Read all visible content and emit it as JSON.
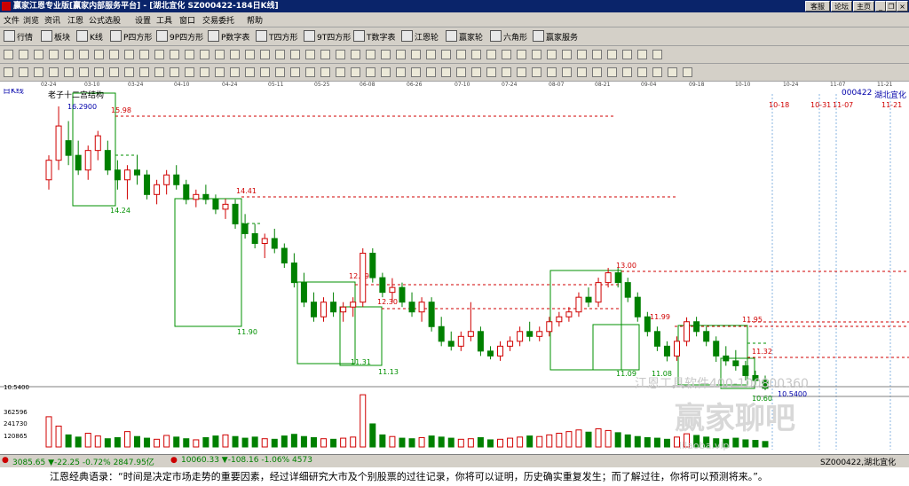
{
  "window": {
    "title": "赢家江恩专业版[赢家内部服务平台] - [湖北宜化  SZ000422-184日K线]",
    "buttons": [
      "客服",
      "论坛",
      "主页"
    ]
  },
  "menu": [
    "文件",
    "浏览",
    "资讯",
    "江恩",
    "公式选股",
    "设置",
    "工具",
    "窗口",
    "交易委托",
    "帮助"
  ],
  "toolbar1": [
    "行情",
    "板块",
    "K线",
    "P四方形",
    "9P四方形",
    "P数字表",
    "T四方形",
    "9T四方形",
    "T数字表",
    "江恩轮",
    "赢家轮",
    "六角形",
    "赢家服务"
  ],
  "chart": {
    "period_label": "日K线",
    "study_label": "老子十二宫结构",
    "stock_code": "000422",
    "stock_name": "湖北宜化",
    "top_dates": [
      "02-24",
      "03-10",
      "03-24",
      "04-10",
      "04-24",
      "05-11",
      "05-25",
      "06-08",
      "06-26",
      "07-10",
      "07-24",
      "08-07",
      "08-21",
      "09-04",
      "09-18",
      "10-10",
      "10-24",
      "11-07",
      "11-21"
    ],
    "future_dates": [
      "10-18",
      "10-31",
      "11-07",
      "11-21"
    ],
    "price_labels": [
      "16.2900",
      "15.98",
      "14.41",
      "14.24",
      "11.90",
      "12.79",
      "12.30",
      "11.31",
      "11.13",
      "13.00",
      "11.99",
      "11.95",
      "11.09",
      "11.08",
      "11.32",
      "10.60",
      "10.5400"
    ],
    "watermark": "江恩工具软件400-100800360",
    "volume_axis": [
      "10.5400",
      "362596",
      "241730",
      "120865"
    ],
    "volume_watermark_brand": "赢家聊吧",
    "volume_watermark_url": "lilaoba.vip"
  },
  "candles": [
    [
      14.8,
      15.3,
      14.6,
      15.2
    ],
    [
      15.2,
      16.3,
      15.0,
      15.9
    ],
    [
      15.6,
      16.0,
      15.1,
      15.3
    ],
    [
      15.3,
      15.6,
      14.9,
      15.0
    ],
    [
      15.0,
      15.5,
      14.8,
      15.4
    ],
    [
      15.4,
      15.8,
      15.2,
      15.7
    ],
    [
      15.4,
      15.6,
      14.9,
      15.0
    ],
    [
      15.0,
      15.2,
      14.6,
      14.8
    ],
    [
      14.8,
      15.1,
      14.4,
      15.0
    ],
    [
      15.0,
      15.3,
      14.7,
      14.9
    ],
    [
      14.9,
      15.0,
      14.4,
      14.5
    ],
    [
      14.5,
      14.8,
      14.3,
      14.7
    ],
    [
      14.7,
      15.0,
      14.5,
      14.9
    ],
    [
      14.9,
      15.1,
      14.6,
      14.7
    ],
    [
      14.7,
      14.8,
      14.3,
      14.4
    ],
    [
      14.4,
      14.6,
      14.24,
      14.5
    ],
    [
      14.5,
      14.7,
      14.3,
      14.4
    ],
    [
      14.4,
      14.5,
      14.1,
      14.2
    ],
    [
      14.2,
      14.41,
      14.0,
      14.3
    ],
    [
      14.3,
      14.4,
      13.8,
      13.9
    ],
    [
      13.9,
      14.1,
      13.6,
      13.7
    ],
    [
      13.7,
      13.9,
      13.4,
      13.5
    ],
    [
      13.5,
      13.7,
      13.2,
      13.6
    ],
    [
      13.6,
      13.8,
      13.3,
      13.4
    ],
    [
      13.4,
      13.5,
      13.0,
      13.1
    ],
    [
      13.1,
      13.3,
      12.6,
      12.7
    ],
    [
      12.7,
      12.9,
      12.2,
      12.3
    ],
    [
      12.3,
      12.5,
      11.9,
      12.0
    ],
    [
      12.0,
      12.4,
      11.9,
      12.3
    ],
    [
      12.3,
      12.5,
      12.0,
      12.1
    ],
    [
      12.1,
      12.3,
      11.9,
      12.2
    ],
    [
      12.2,
      12.4,
      12.0,
      12.3
    ],
    [
      12.3,
      13.4,
      12.2,
      13.3
    ],
    [
      13.3,
      13.4,
      12.7,
      12.8
    ],
    [
      12.8,
      12.9,
      12.4,
      12.5
    ],
    [
      12.5,
      12.79,
      12.3,
      12.6
    ],
    [
      12.6,
      12.7,
      12.2,
      12.3
    ],
    [
      12.3,
      12.5,
      12.0,
      12.1
    ],
    [
      12.1,
      12.4,
      11.9,
      12.3
    ],
    [
      12.3,
      12.4,
      11.7,
      11.8
    ],
    [
      11.8,
      12.0,
      11.4,
      11.5
    ],
    [
      11.5,
      11.7,
      11.31,
      11.4
    ],
    [
      11.4,
      11.7,
      11.3,
      11.6
    ],
    [
      11.6,
      12.3,
      11.5,
      11.7
    ],
    [
      11.7,
      11.8,
      11.2,
      11.3
    ],
    [
      11.3,
      11.4,
      11.13,
      11.2
    ],
    [
      11.2,
      11.5,
      11.1,
      11.4
    ],
    [
      11.4,
      11.6,
      11.3,
      11.5
    ],
    [
      11.5,
      11.8,
      11.4,
      11.7
    ],
    [
      11.7,
      11.9,
      11.5,
      11.6
    ],
    [
      11.6,
      11.8,
      11.5,
      11.7
    ],
    [
      11.7,
      12.0,
      11.6,
      11.9
    ],
    [
      11.9,
      12.1,
      11.8,
      12.0
    ],
    [
      12.0,
      12.2,
      11.9,
      12.1
    ],
    [
      12.1,
      12.5,
      12.0,
      12.4
    ],
    [
      12.4,
      12.6,
      12.2,
      12.3
    ],
    [
      12.3,
      12.8,
      12.2,
      12.7
    ],
    [
      12.7,
      13.0,
      12.6,
      12.9
    ],
    [
      12.9,
      13.0,
      12.6,
      12.7
    ],
    [
      12.7,
      12.8,
      12.3,
      12.4
    ],
    [
      12.4,
      12.5,
      11.9,
      12.0
    ],
    [
      12.0,
      12.1,
      11.6,
      11.7
    ],
    [
      11.7,
      11.8,
      11.3,
      11.4
    ],
    [
      11.4,
      11.5,
      11.09,
      11.2
    ],
    [
      11.2,
      11.6,
      11.1,
      11.5
    ],
    [
      11.5,
      11.99,
      11.4,
      11.9
    ],
    [
      11.9,
      12.0,
      11.6,
      11.7
    ],
    [
      11.7,
      11.8,
      11.4,
      11.5
    ],
    [
      11.5,
      11.6,
      11.08,
      11.2
    ],
    [
      11.2,
      11.4,
      11.0,
      11.1
    ],
    [
      11.1,
      11.32,
      10.9,
      11.0
    ],
    [
      11.0,
      11.1,
      10.7,
      10.8
    ],
    [
      10.8,
      10.9,
      10.6,
      10.7
    ],
    [
      10.7,
      10.8,
      10.5,
      10.54
    ]
  ],
  "volumes": [
    0.55,
    0.38,
    0.22,
    0.18,
    0.25,
    0.2,
    0.15,
    0.17,
    0.28,
    0.19,
    0.16,
    0.14,
    0.21,
    0.18,
    0.15,
    0.13,
    0.17,
    0.2,
    0.22,
    0.19,
    0.16,
    0.18,
    0.15,
    0.14,
    0.2,
    0.23,
    0.19,
    0.17,
    0.15,
    0.14,
    0.16,
    0.18,
    0.95,
    0.42,
    0.22,
    0.19,
    0.16,
    0.15,
    0.17,
    0.2,
    0.18,
    0.16,
    0.14,
    0.15,
    0.17,
    0.13,
    0.14,
    0.16,
    0.18,
    0.2,
    0.19,
    0.22,
    0.25,
    0.28,
    0.31,
    0.27,
    0.33,
    0.3,
    0.26,
    0.22,
    0.19,
    0.17,
    0.16,
    0.14,
    0.18,
    0.24,
    0.21,
    0.18,
    0.15,
    0.14,
    0.16,
    0.13,
    0.12,
    0.1
  ],
  "bottom": {
    "sh_index": "3085.65 ▼-22.25 -0.72% 2847.95亿",
    "sz_index": "10060.33 ▼-108.16 -1.06% 4573",
    "stock": "SZ000422,湖北宜化"
  },
  "quote": "江恩经典语录：“时间是决定市场走势的重要因素，经过详细研究大市及个别股票的过往记录，你将可以证明，历史确实重复发生；而了解过往，你将可以预测将来。”。"
}
